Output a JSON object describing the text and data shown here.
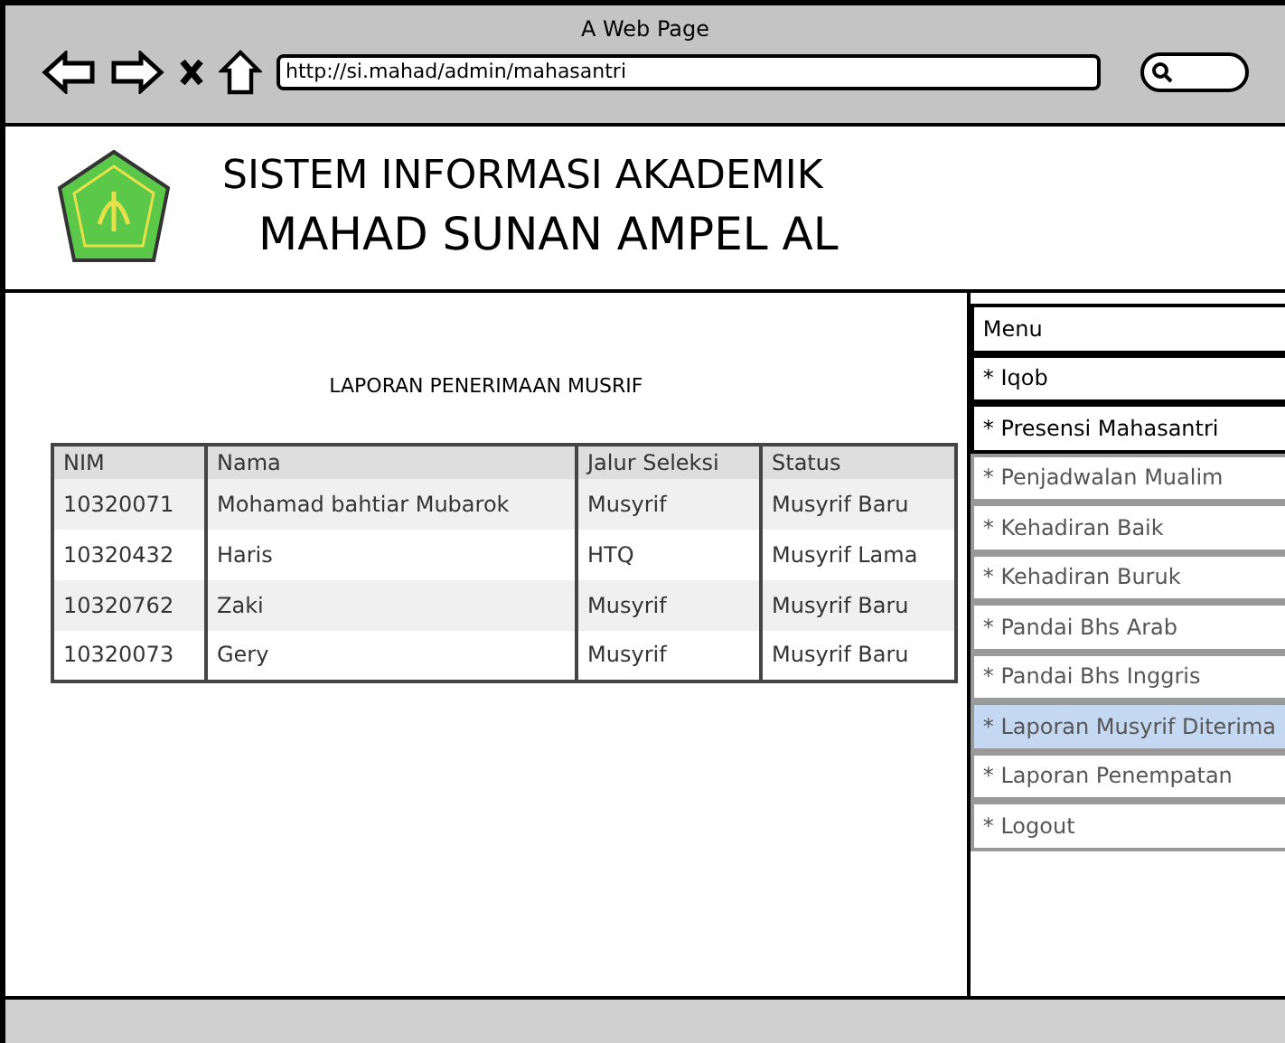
{
  "window": {
    "title": "A Web Page",
    "url": "http://si.mahad/admin/mahasantri"
  },
  "header": {
    "line_1": "SISTEM INFORMASI AKADEMIK",
    "line_2": "MAHAD SUNAN AMPEL AL"
  },
  "report": {
    "title": "LAPORAN PENERIMAAN MUSRIF",
    "columns": [
      "NIM",
      "Nama",
      "Jalur Seleksi",
      "Status"
    ],
    "rows": [
      [
        "10320071",
        "Mohamad bahtiar Mubarok",
        "Musyrif",
        "Musyrif Baru"
      ],
      [
        "10320432",
        "Haris",
        "HTQ",
        "Musyrif Lama"
      ],
      [
        "10320762",
        "Zaki",
        "Musyrif",
        "Musyrif Baru"
      ],
      [
        "10320073",
        "Gery",
        "Musyrif",
        "Musyrif Baru"
      ]
    ]
  },
  "sidebar": {
    "items": [
      {
        "label": "Menu",
        "emphasized": true,
        "selected": false
      },
      {
        "label": "* Iqob",
        "emphasized": true,
        "selected": false
      },
      {
        "label": "* Presensi Mahasantri",
        "emphasized": true,
        "selected": false
      },
      {
        "label": "* Penjadwalan Mualim",
        "emphasized": false,
        "selected": false
      },
      {
        "label": "* Kehadiran Baik",
        "emphasized": false,
        "selected": false
      },
      {
        "label": "* Kehadiran Buruk",
        "emphasized": false,
        "selected": false
      },
      {
        "label": "* Pandai Bhs Arab",
        "emphasized": false,
        "selected": false
      },
      {
        "label": "* Pandai Bhs Inggris",
        "emphasized": false,
        "selected": false
      },
      {
        "label": "* Laporan Musyrif Diterima",
        "emphasized": false,
        "selected": true
      },
      {
        "label": "* Laporan Penempatan",
        "emphasized": false,
        "selected": false
      },
      {
        "label": "* Logout",
        "emphasized": false,
        "selected": false
      }
    ]
  }
}
